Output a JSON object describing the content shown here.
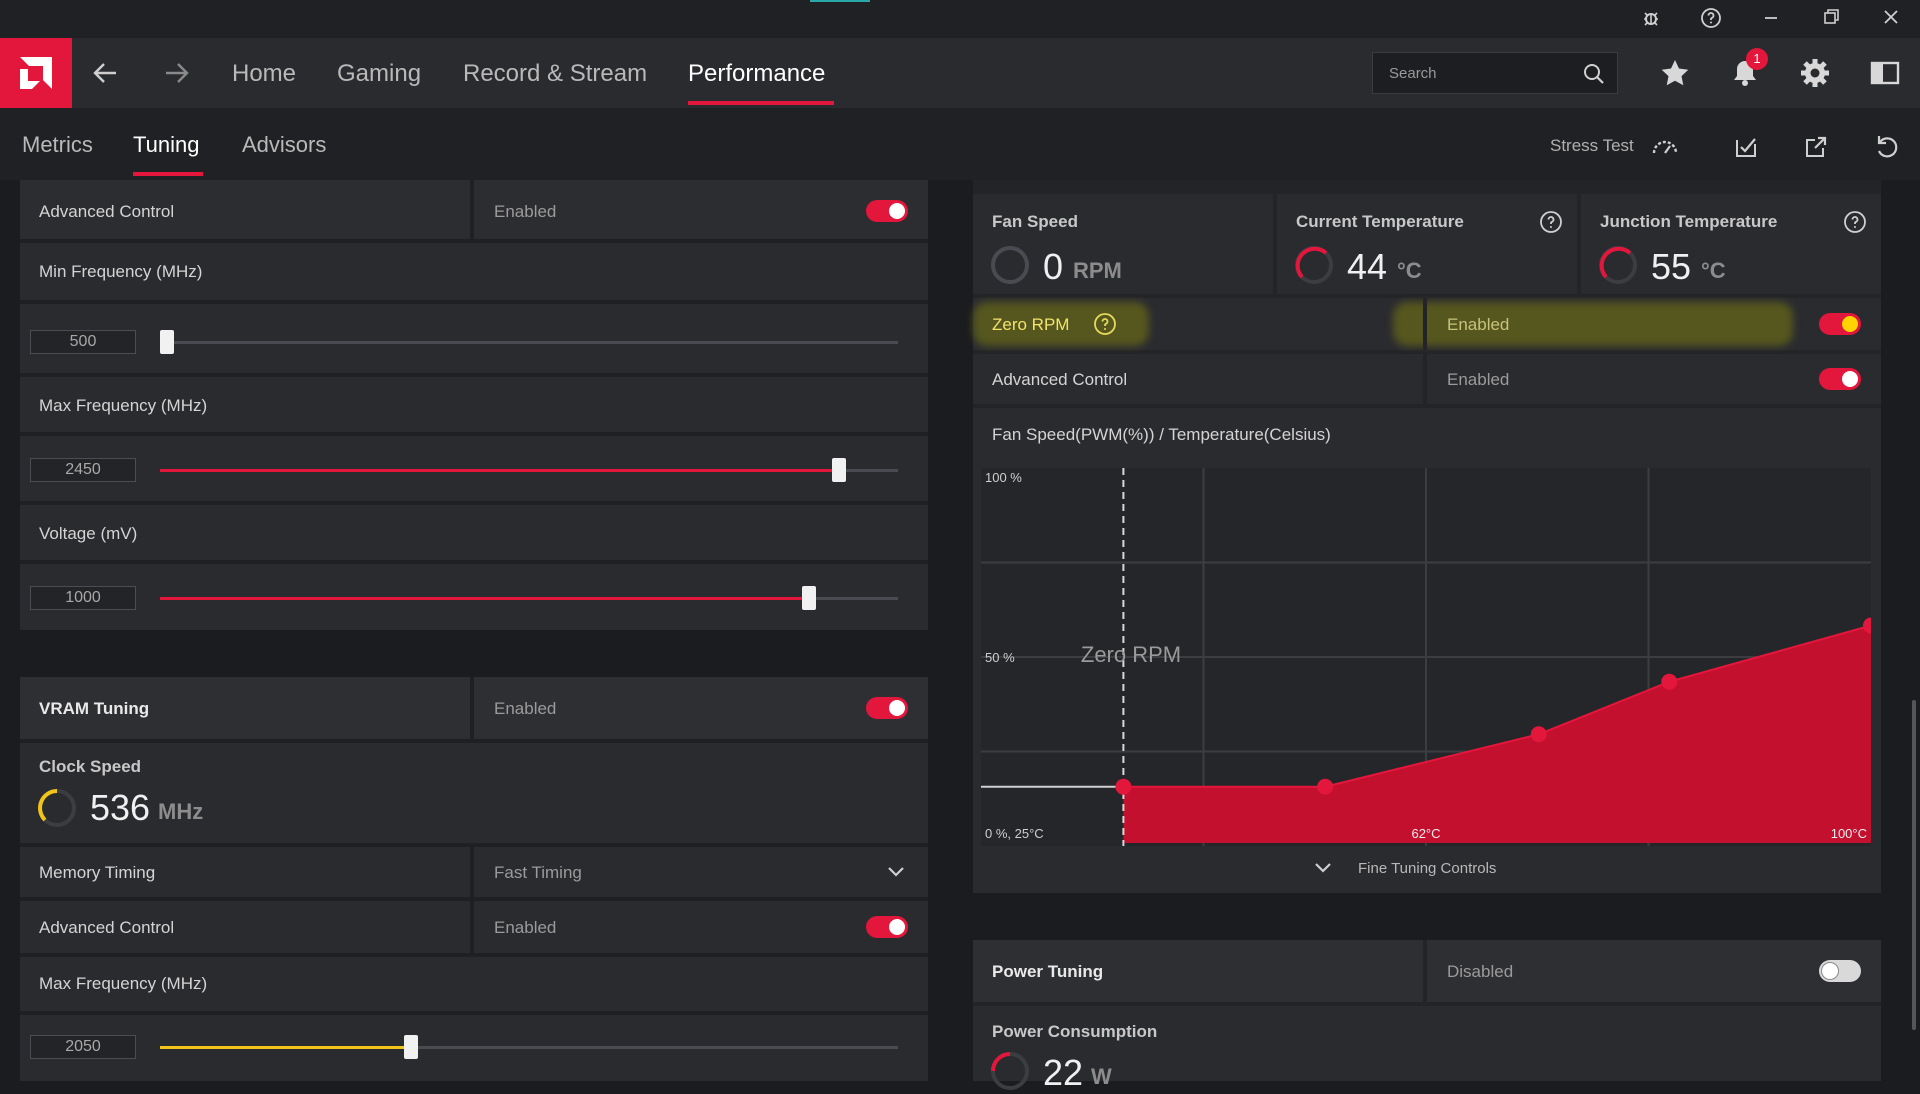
{
  "window": {
    "controls": [
      "bug-report",
      "help",
      "minimize",
      "restore",
      "close"
    ]
  },
  "nav": {
    "items": [
      "Home",
      "Gaming",
      "Record & Stream",
      "Performance"
    ],
    "active": "Performance",
    "search_placeholder": "Search",
    "notification_count": "1",
    "accent_color": "#e3163c"
  },
  "subnav": {
    "items": [
      "Metrics",
      "Tuning",
      "Advisors"
    ],
    "active": "Tuning",
    "stress_test": "Stress Test"
  },
  "gpu_tuning": {
    "advanced_control_label": "Advanced Control",
    "advanced_control_value": "Enabled",
    "min_freq_label": "Min Frequency (MHz)",
    "min_freq_value": "500",
    "min_freq_level": 0.01,
    "max_freq_label": "Max Frequency (MHz)",
    "max_freq_value": "2450",
    "max_freq_level": 0.92,
    "voltage_label": "Voltage (mV)",
    "voltage_value": "1000",
    "voltage_level": 0.88
  },
  "vram_tuning": {
    "title": "VRAM Tuning",
    "status": "Enabled",
    "clock_speed_label": "Clock Speed",
    "clock_speed_value": "536",
    "clock_speed_unit": "MHz",
    "memory_timing_label": "Memory Timing",
    "memory_timing_value": "Fast Timing",
    "advanced_control_label": "Advanced Control",
    "advanced_control_value": "Enabled",
    "max_freq_label": "Max Frequency (MHz)",
    "max_freq_value": "2050",
    "max_freq_level": 0.34
  },
  "fan_tuning": {
    "fan_speed_label": "Fan Speed",
    "fan_speed_value": "0",
    "fan_speed_unit": "RPM",
    "current_temp_label": "Current Temperature",
    "current_temp_value": "44",
    "temp_unit": "°C",
    "junction_temp_label": "Junction Temperature",
    "junction_temp_value": "55",
    "zero_rpm_label": "Zero RPM",
    "zero_rpm_value": "Enabled",
    "advanced_control_label": "Advanced Control",
    "advanced_control_value": "Enabled",
    "chart_title": "Fan Speed(PWM(%)) / Temperature(Celsius)",
    "fine_tuning": "Fine Tuning Controls"
  },
  "chart_data": {
    "type": "area",
    "title": "Fan Speed(PWM(%)) / Temperature(Celsius)",
    "x_range": [
      25,
      100
    ],
    "y_range": [
      0,
      100
    ],
    "tick_labels": {
      "y_top": "100 %",
      "y_mid": "50 %",
      "origin": "0 %, 25°C",
      "x_mid": "62°C",
      "x_end": "100°C"
    },
    "zero_rpm_annotation": "Zero RPM",
    "zero_rpm_threshold_c": 37,
    "points": [
      {
        "x": 37,
        "y": 15
      },
      {
        "x": 54,
        "y": 15
      },
      {
        "x": 72,
        "y": 29
      },
      {
        "x": 83,
        "y": 43
      },
      {
        "x": 100,
        "y": 58
      }
    ],
    "fill_color": "#c4102f"
  },
  "power_tuning": {
    "title": "Power Tuning",
    "status": "Disabled",
    "consumption_label": "Power Consumption",
    "consumption_value": "22",
    "consumption_unit": "W"
  }
}
